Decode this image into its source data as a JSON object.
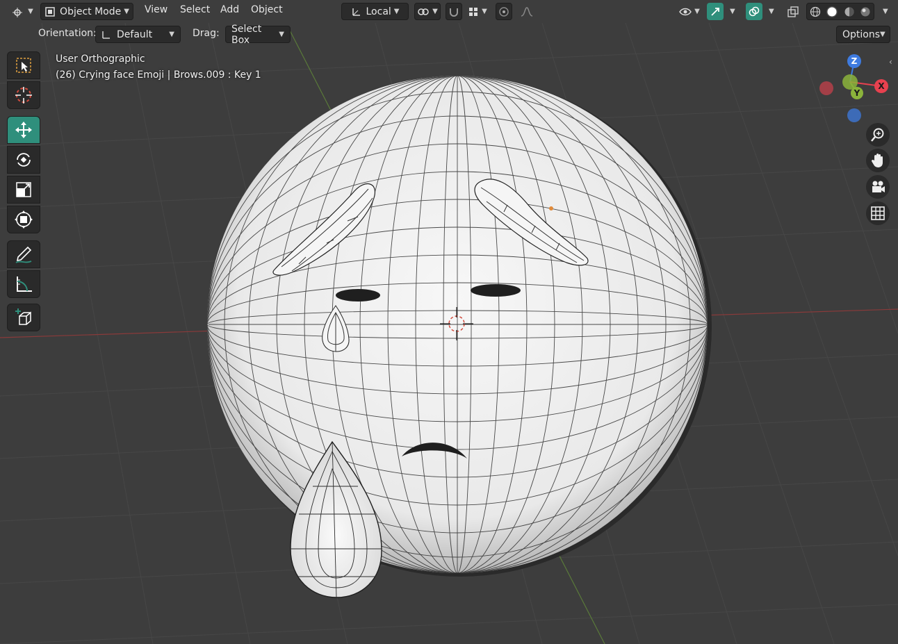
{
  "header": {
    "mode_label": "Object Mode",
    "menu": [
      "View",
      "Select",
      "Add",
      "Object"
    ],
    "transform_pivot_label": "Local",
    "options_label": "Options"
  },
  "subheader": {
    "orientation_label": "Orientation:",
    "orientation_value": "Default",
    "drag_label": "Drag:",
    "drag_value": "Select Box"
  },
  "viewport": {
    "view_name": "User Orthographic",
    "object_info": "(26) Crying face Emoji | Brows.009 : Key 1"
  },
  "gizmo": {
    "z_label": "Z",
    "y_label": "Y",
    "x_label": "X",
    "x_color": "#e8414f",
    "y_color": "#8bb33b",
    "z_color": "#3e7be0"
  },
  "toolbar": {
    "tools": [
      "select-box-icon",
      "cursor-icon",
      "move-icon",
      "rotate-icon",
      "scale-icon",
      "transform-icon",
      "annotate-icon",
      "measure-icon",
      "add-cube-icon"
    ],
    "active_tool": "move-icon"
  },
  "colors": {
    "background": "#3d3d3d",
    "active": "#2f8f7c",
    "mesh": "#f2f2f2"
  }
}
